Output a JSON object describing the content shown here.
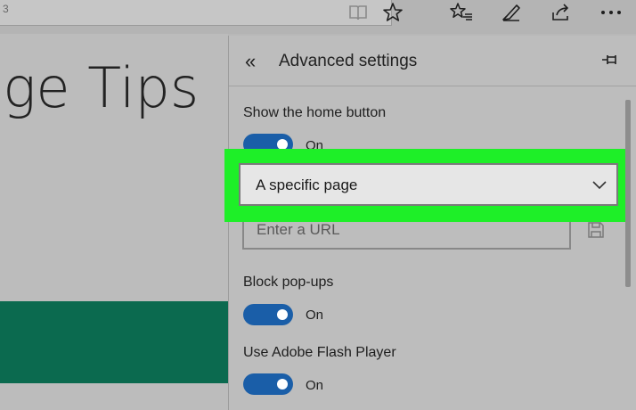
{
  "toolbar": {
    "address_tail": "3",
    "icons": [
      "reading-view-icon",
      "favorite-star-icon",
      "favorites-list-icon",
      "web-note-icon",
      "share-icon",
      "more-icon"
    ]
  },
  "page": {
    "title": "lge Tips"
  },
  "panel": {
    "title": "Advanced settings",
    "show_home_label": "Show the home button",
    "show_home_state": "On",
    "home_dropdown_value": "A specific page",
    "url_placeholder": "Enter a URL",
    "block_popups_label": "Block pop-ups",
    "block_popups_state": "On",
    "flash_label": "Use Adobe Flash Player",
    "flash_state": "On"
  },
  "colors": {
    "highlight": "#1eef28",
    "toggle_on": "#1a5ea8",
    "banner": "#0b6a4f"
  }
}
